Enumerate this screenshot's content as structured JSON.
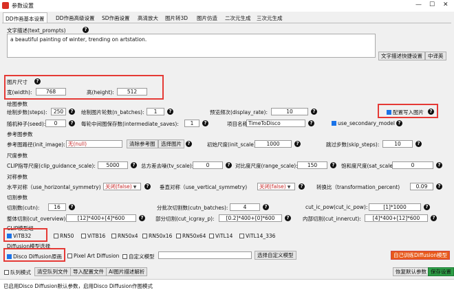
{
  "window": {
    "title": "参数设置",
    "minimize": "—",
    "maximize": "☐",
    "close": "✕"
  },
  "tabs": [
    "DD作画基本设置",
    "DD作画高级设置",
    "SD作画设置",
    "高清放大",
    "图片转3D",
    "图片仿造",
    "二次元生成",
    "三次元生成"
  ],
  "text_prompts": {
    "label": "文字描述(text_prompts)",
    "value": "a beautiful painting of winter, trending on artstation.",
    "quick_btn": "文字描述快捷设置",
    "translate_btn": "中译英"
  },
  "size": {
    "section": "图片尺寸",
    "width_label": "宽(width):",
    "width": "768",
    "height_label": "高(height):",
    "height": "512"
  },
  "draw": {
    "section": "绘图参数",
    "steps_label": "绘制步数(steps):",
    "steps": "250",
    "n_batches_label": "绘制图片轮数(n_batches):",
    "n_batches": "1",
    "display_rate_label": "预览频次(display_rate):",
    "display_rate": "10",
    "write_cfg_label": "配置写入图片",
    "seed_label": "随机种子(seed):",
    "seed": "0",
    "saves_label": "每轮中间图保存数(intermediate_saves):",
    "saves": "1",
    "project_label": "项目名称",
    "project": "TimeToDisco",
    "secondary_label": "use_secondary_model"
  },
  "ref": {
    "section": "参考图参数",
    "init_image_label": "参考图路径(init_image):",
    "init_image": "无(null)",
    "clear_btn": "清除参考图",
    "choose_btn": "选择图片",
    "init_scale_label": "初始尺度(init_scale):",
    "init_scale": "1000",
    "skip_label": "跳过步数(skip_steps):",
    "skip": "10"
  },
  "scale": {
    "section": "尺度参数",
    "cgs_label": "CLIP指导尺度(clip_guidance_scale):",
    "cgs": "5000",
    "tv_label": "总方差去噪(tv_scale):",
    "tv": "0",
    "range_label": "对比度尺度(range_scale):",
    "range": "150",
    "sat_label": "饱和度尺度(sat_scale):",
    "sat": "0"
  },
  "sym": {
    "section": "对称参数",
    "h_label": "水平对称（use_horizontal_symmetry)",
    "h": "关闭(false)",
    "v_label": "垂直对称（use_vertical_symmetry)",
    "v": "关闭(false)",
    "t_label": "转换比（transformation_percent)",
    "t": "0.09"
  },
  "cut": {
    "section": "切割参数",
    "cutn_label": "切割数(cutn):",
    "cutn": "16",
    "batches_label": "分批次切割数(cutn_batches):",
    "batches": "4",
    "pow_label": "cut_ic_pow(cut_ic_pow):",
    "pow": "[1]*1000",
    "overview_label": "整体切割(cut_overview):",
    "overview": "[12]*400+[4]*600",
    "icgray_label": "部分切割(cut_icgray_p):",
    "icgray": "[0.2]*400+[0]*600",
    "inner_label": "内部切割(cut_innercut):",
    "inner": "[4]*400+[12]*600"
  },
  "clip": {
    "section": "CLIP模型组",
    "models": [
      "ViTB32",
      "RN50",
      "ViTB16",
      "RN50x4",
      "RN50x16",
      "RN50x64",
      "ViTL14",
      "ViTL14_336"
    ],
    "checked": [
      "ViTB32"
    ]
  },
  "diffusion": {
    "section": "Diffusion模型选择",
    "disco": "Disco Diffusion原画",
    "pixel": "Pixel Art Diffusion",
    "custom": "自定义模型",
    "choose_btn": "选择自定义模型",
    "train_btn": "自己训练Diffusion模型"
  },
  "bottom": {
    "queue": "队列模式",
    "clear_queue": "清空队列文件",
    "import": "导入配置文件",
    "ai_desc": "AI图片描述解析",
    "restore": "恢复默认参数",
    "save": "保存设置"
  },
  "status": "已启用Disco Diffusion默认参数，启用Disco Diffusion作图模式",
  "colors": {
    "highlight": "#e53935",
    "orange": "#e8591a",
    "green": "#2e9e47",
    "checkbox": "#1a73e8"
  }
}
